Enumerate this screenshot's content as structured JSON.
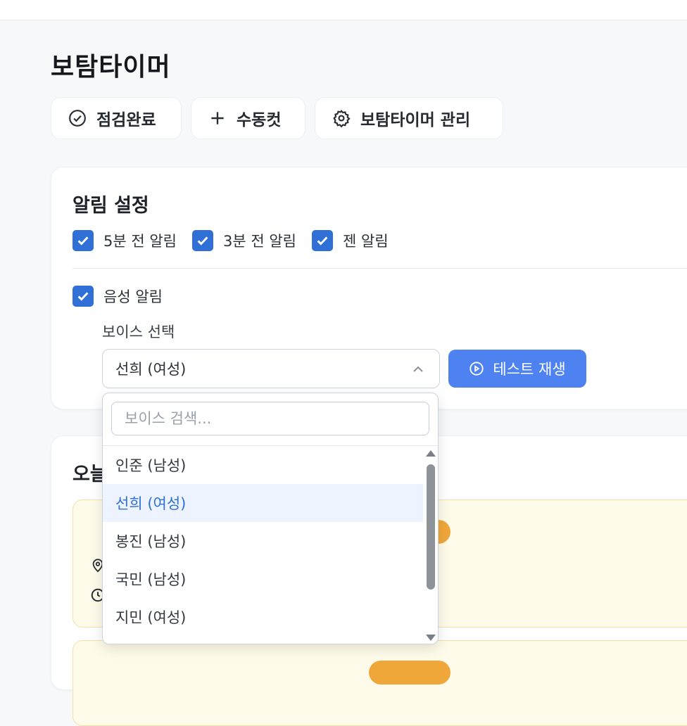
{
  "page": {
    "title": "보탐타이머"
  },
  "actions": [
    {
      "label": "점검완료",
      "icon": "check-circle-icon"
    },
    {
      "label": "수동컷",
      "icon": "plus-icon"
    },
    {
      "label": "보탐타이머 관리",
      "icon": "gear-icon"
    }
  ],
  "alarm_settings": {
    "title": "알림 설정",
    "checkboxes": [
      {
        "label": "5분 전 알림",
        "checked": true
      },
      {
        "label": "3분 전 알림",
        "checked": true
      },
      {
        "label": "젠 알림",
        "checked": true
      }
    ],
    "voice_alarm": {
      "label": "음성 알림",
      "checked": true
    },
    "voice_select_label": "보이스 선택",
    "voice_selected": "선희 (여성)",
    "test_button": "테스트 재생"
  },
  "dropdown": {
    "search_placeholder": "보이스 검색...",
    "options": [
      "인준 (남성)",
      "선희 (여성)",
      "봉진 (남성)",
      "국민 (남성)",
      "지민 (여성)"
    ],
    "selected_index": 1
  },
  "today": {
    "title": "오늘"
  },
  "colors": {
    "accent": "#2f6fd6",
    "button_primary": "#4d82f0",
    "event_bg": "#fffbea",
    "pill": "#f0a73a"
  }
}
